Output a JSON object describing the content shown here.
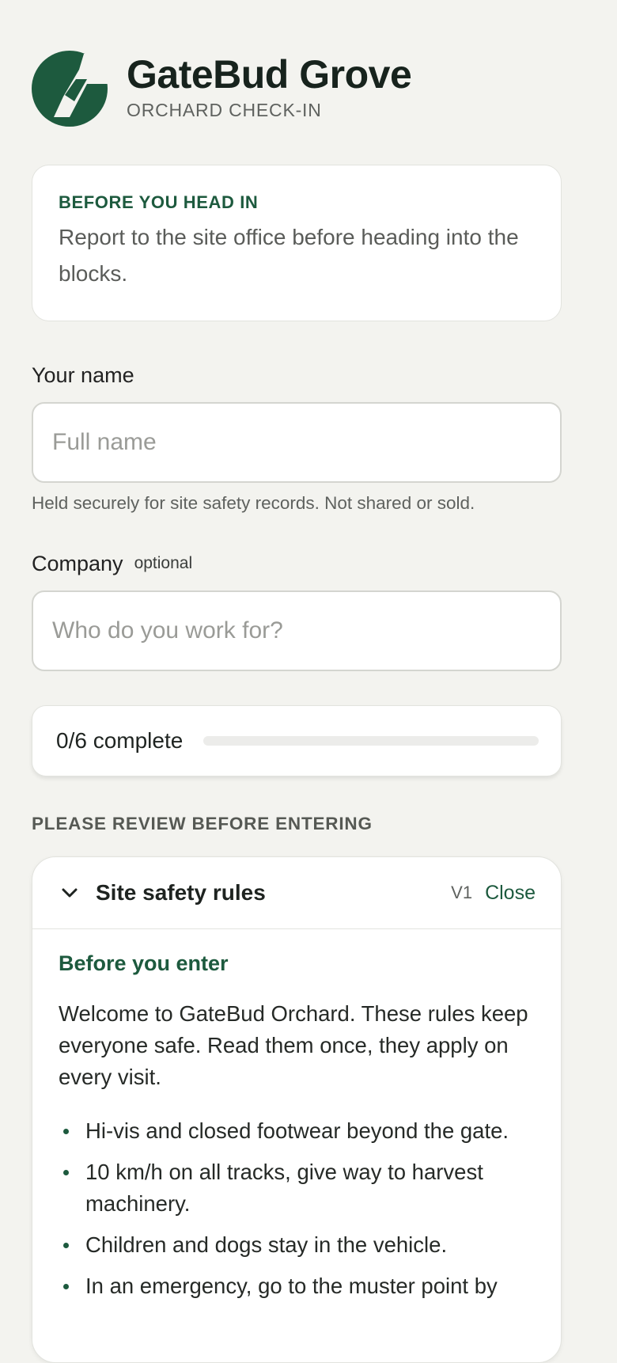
{
  "brand": {
    "title": "GateBud Grove",
    "subtitle": "ORCHARD CHECK-IN",
    "logo_icon": "leaf-logo-icon",
    "accent_color": "#1d5a3e"
  },
  "notice": {
    "title": "BEFORE YOU HEAD IN",
    "body": "Report to the site office before heading into the blocks."
  },
  "form": {
    "name": {
      "label": "Your name",
      "placeholder": "Full name",
      "value": "",
      "hint": "Held securely for site safety records. Not shared or sold."
    },
    "company": {
      "label": "Company",
      "optional_tag": "optional",
      "placeholder": "Who do you work for?",
      "value": ""
    }
  },
  "progress": {
    "text": "0/6 complete",
    "completed": 0,
    "total": 6
  },
  "review_heading": "PLEASE REVIEW BEFORE ENTERING",
  "rules": {
    "title": "Site safety rules",
    "version": "V1",
    "close_label": "Close",
    "expanded": true,
    "subheading": "Before you enter",
    "intro": "Welcome to GateBud Orchard. These rules keep everyone safe. Read them once, they apply on every visit.",
    "items": [
      "Hi-vis and closed footwear beyond the gate.",
      "10 km/h on all tracks, give way to harvest machinery.",
      "Children and dogs stay in the vehicle.",
      "In an emergency, go to the muster point by"
    ]
  }
}
